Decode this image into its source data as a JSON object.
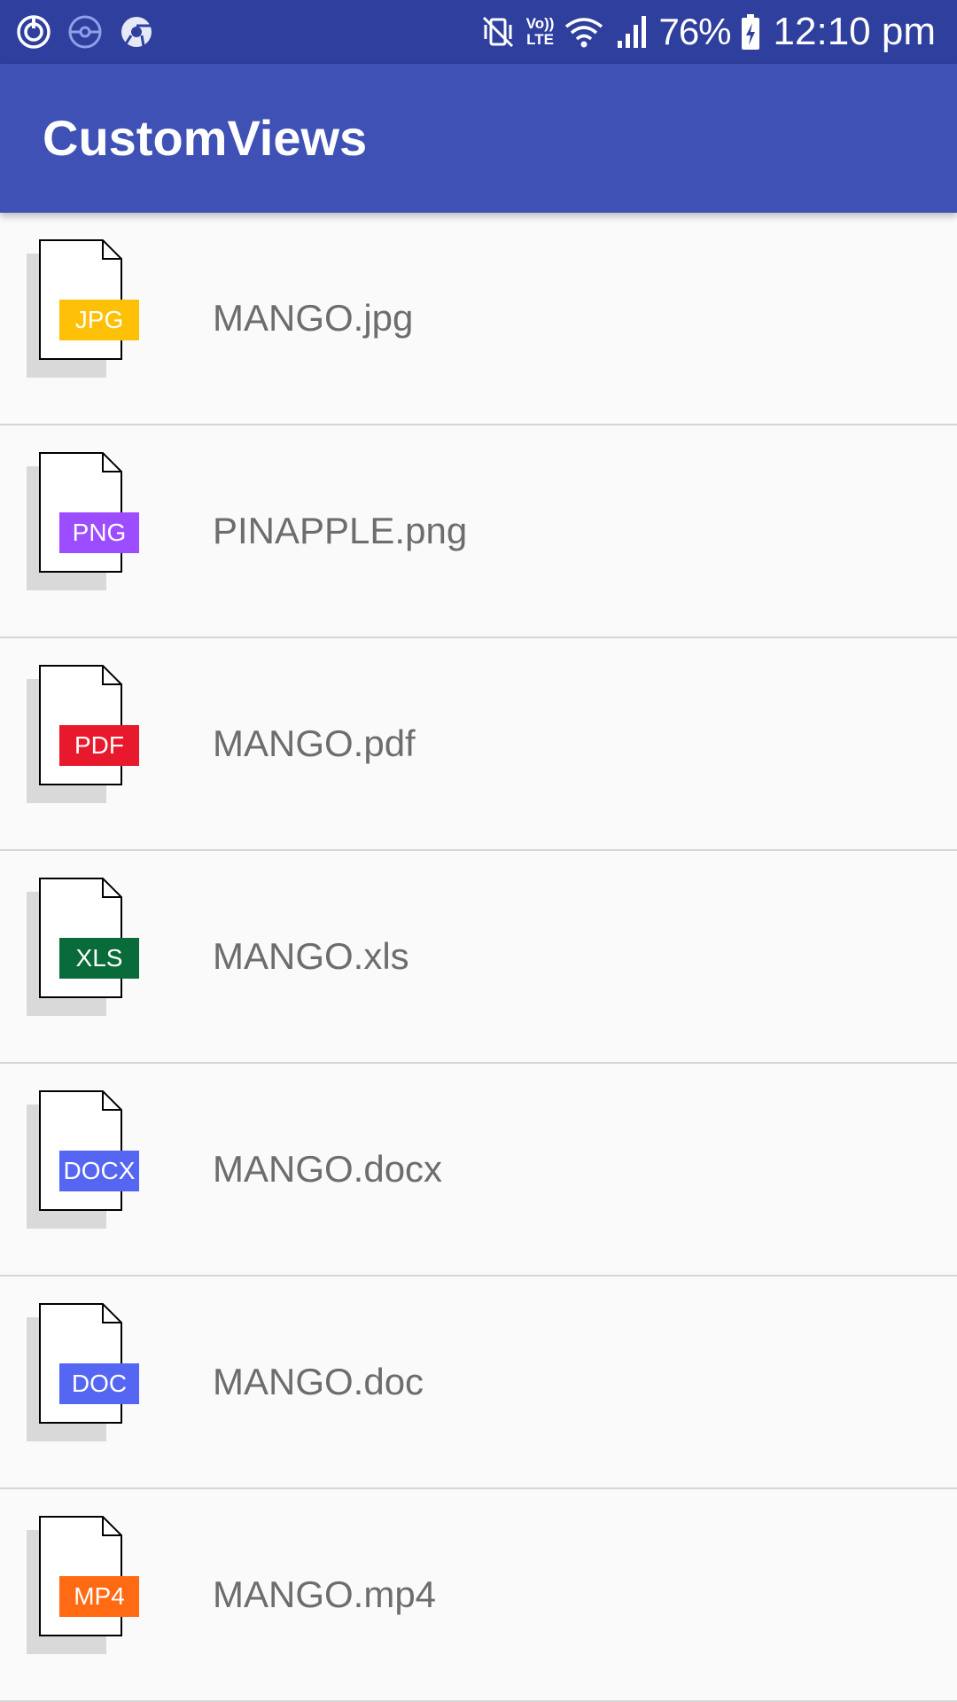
{
  "status_bar": {
    "left_icons": [
      "sync-icon",
      "pokemon-go-icon",
      "chrome-icon"
    ],
    "right_icons": [
      "vibrate-mute-icon",
      "volte-icon",
      "wifi-icon",
      "signal-icon",
      "battery-charging-icon"
    ],
    "volte_top": "Vo))",
    "volte_bottom": "LTE",
    "battery": "76%",
    "time": "12:10 pm"
  },
  "app_bar": {
    "title": "CustomViews"
  },
  "files": [
    {
      "name": "MANGO.jpg",
      "ext": "JPG",
      "color": "#ffc107"
    },
    {
      "name": "PINAPPLE.png",
      "ext": "PNG",
      "color": "#9c4dff"
    },
    {
      "name": "MANGO.pdf",
      "ext": "PDF",
      "color": "#e8192c"
    },
    {
      "name": "MANGO.xls",
      "ext": "XLS",
      "color": "#0a6b3a"
    },
    {
      "name": "MANGO.docx",
      "ext": "DOCX",
      "color": "#5566f2"
    },
    {
      "name": "MANGO.doc",
      "ext": "DOC",
      "color": "#5566f2"
    },
    {
      "name": "MANGO.mp4",
      "ext": "MP4",
      "color": "#ff6a13"
    }
  ],
  "colors": {
    "status_bar": "#2f3f9e",
    "app_bar": "#3f51b5",
    "background": "#fafafa",
    "file_name_text": "#6d6d6d",
    "divider": "#d6d6d6"
  }
}
